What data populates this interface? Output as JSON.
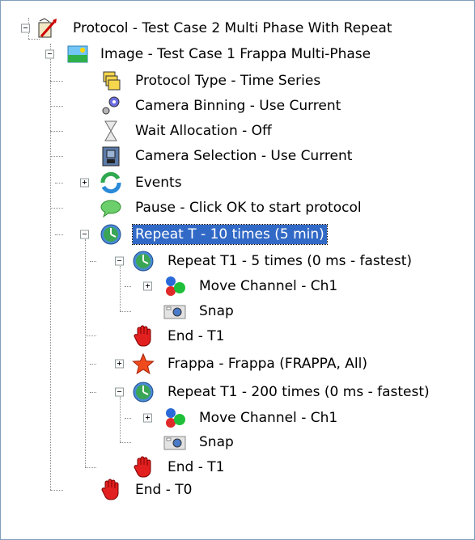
{
  "tree": {
    "nodes": [
      {
        "id": "n0",
        "label": "Protocol - Test Case 2 Multi Phase With Repeat",
        "icon": "protocol-icon",
        "level": 0,
        "expander": "minus"
      },
      {
        "id": "n1",
        "label": "Image - Test Case 1 Frappa Multi-Phase",
        "icon": "image-icon",
        "level": 1,
        "expander": "minus"
      },
      {
        "id": "n2",
        "label": "Protocol Type - Time Series",
        "icon": "protocol-type-icon",
        "level": 2,
        "expander": ""
      },
      {
        "id": "n3",
        "label": "Camera Binning - Use Current",
        "icon": "camera-binning-icon",
        "level": 2,
        "expander": ""
      },
      {
        "id": "n4",
        "label": "Wait Allocation - Off",
        "icon": "hourglass-icon",
        "level": 2,
        "expander": ""
      },
      {
        "id": "n5",
        "label": "Camera Selection - Use Current",
        "icon": "camera-selection-icon",
        "level": 2,
        "expander": ""
      },
      {
        "id": "n6",
        "label": "Events",
        "icon": "events-icon",
        "level": 2,
        "expander": "plus"
      },
      {
        "id": "n7",
        "label": "Pause - Click OK to start protocol",
        "icon": "pause-icon",
        "level": 2,
        "expander": ""
      },
      {
        "id": "n8",
        "label": "Repeat T - 10 times (5 min)",
        "icon": "repeat-clock-icon",
        "level": 2,
        "expander": "minus",
        "selected": true
      },
      {
        "id": "n9",
        "label": "Repeat T1 - 5 times (0 ms - fastest)",
        "icon": "repeat-clock-icon",
        "level": 3,
        "expander": "minus"
      },
      {
        "id": "n10",
        "label": "Move Channel - Ch1",
        "icon": "move-channel-icon",
        "level": 4,
        "expander": "plus"
      },
      {
        "id": "n11",
        "label": "Snap",
        "icon": "snap-camera-icon",
        "level": 4,
        "expander": ""
      },
      {
        "id": "n12",
        "label": "End - T1",
        "icon": "stop-hand-icon",
        "level": 3,
        "expander": ""
      },
      {
        "id": "n13",
        "label": "Frappa - Frappa (FRAPPA, All)",
        "icon": "frappa-star-icon",
        "level": 3,
        "expander": "plus"
      },
      {
        "id": "n14",
        "label": "Repeat T1 - 200 times (0 ms - fastest)",
        "icon": "repeat-clock-icon",
        "level": 3,
        "expander": "minus"
      },
      {
        "id": "n15",
        "label": "Move Channel - Ch1",
        "icon": "move-channel-icon",
        "level": 4,
        "expander": "plus"
      },
      {
        "id": "n16",
        "label": "Snap",
        "icon": "snap-camera-icon",
        "level": 4,
        "expander": ""
      },
      {
        "id": "n17",
        "label": "End - T1",
        "icon": "stop-hand-icon",
        "level": 3,
        "expander": ""
      },
      {
        "id": "n18",
        "label": "End - T0",
        "icon": "stop-hand-icon",
        "level": 2,
        "expander": ""
      }
    ]
  },
  "colors": {
    "selection": "#3169c6",
    "tree_lines": "#8c8c8c",
    "border": "#7f9db9"
  }
}
